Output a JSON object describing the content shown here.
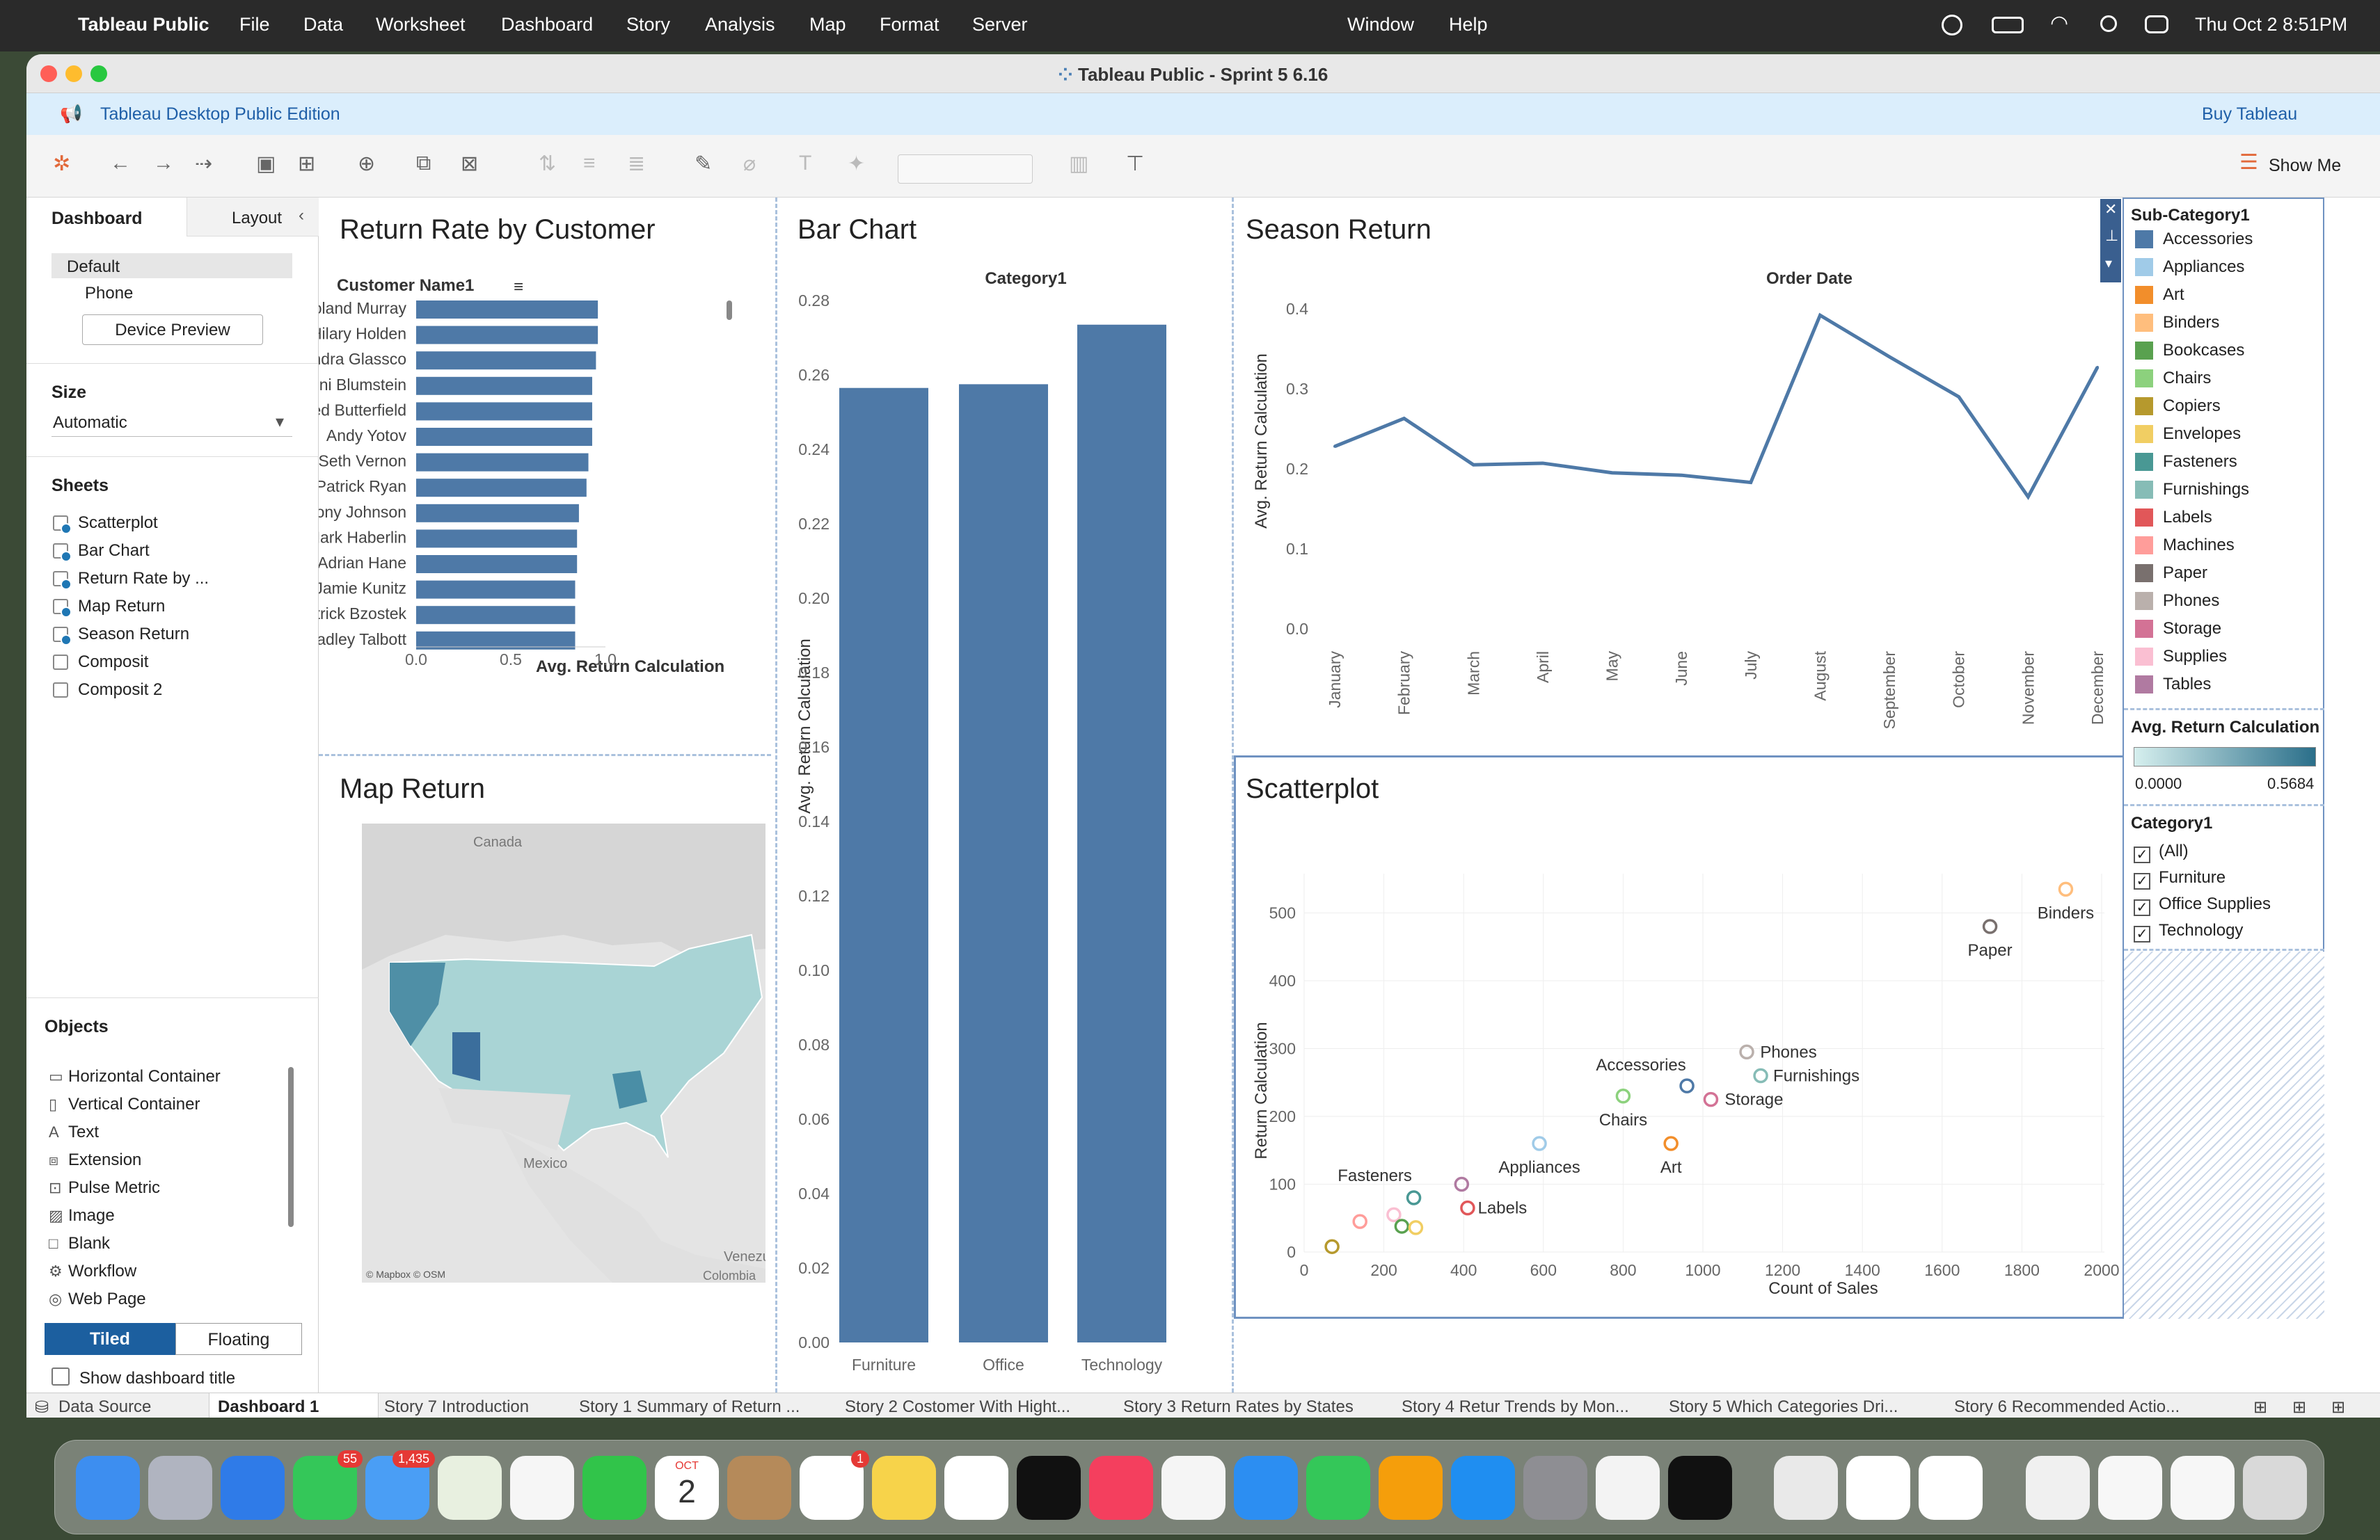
{
  "menubar": {
    "app": "Tableau Public",
    "items": [
      "File",
      "Data",
      "Worksheet",
      "Dashboard",
      "Story",
      "Analysis",
      "Map",
      "Format",
      "Server"
    ],
    "right_items": [
      "Window",
      "Help"
    ],
    "datetime": "Thu Oct 2  8:51PM"
  },
  "window": {
    "title": "Tableau Public - Sprint 5 6.16"
  },
  "banner": {
    "edition": "Tableau Desktop Public Edition",
    "buy": "Buy Tableau"
  },
  "toolbar": {
    "show_me": "Show Me"
  },
  "left": {
    "tab_dashboard": "Dashboard",
    "tab_layout": "Layout",
    "device_default": "Default",
    "device_phone": "Phone",
    "device_preview": "Device Preview",
    "size_header": "Size",
    "size_value": "Automatic",
    "sheets_header": "Sheets",
    "sheets": [
      "Scatterplot",
      "Bar Chart",
      "Return Rate by ...",
      "Map Return",
      "Season Return",
      "Composit",
      "Composit 2"
    ],
    "objects_header": "Objects",
    "objects": [
      "Horizontal Container",
      "Vertical Container",
      "Text",
      "Extension",
      "Pulse Metric",
      "Image",
      "Blank",
      "Workflow",
      "Web Page"
    ],
    "tiled": "Tiled",
    "floating": "Floating",
    "show_title": "Show dashboard title"
  },
  "panels": {
    "return_rate": "Return Rate by Customer",
    "bar_chart": "Bar Chart",
    "season": "Season Return",
    "map": "Map Return",
    "scatter": "Scatterplot"
  },
  "map": {
    "canada": "Canada",
    "mexico": "Mexico",
    "venezuela": "Venezu",
    "colombia": "Colombia",
    "credit": "© Mapbox © OSM"
  },
  "legend": {
    "subcat_title": "Sub-Category1",
    "subcats": [
      {
        "name": "Accessories",
        "color": "#4e79a7"
      },
      {
        "name": "Appliances",
        "color": "#a0cbe8"
      },
      {
        "name": "Art",
        "color": "#f28e2b"
      },
      {
        "name": "Binders",
        "color": "#ffbe7d"
      },
      {
        "name": "Bookcases",
        "color": "#59a14f"
      },
      {
        "name": "Chairs",
        "color": "#8cd17d"
      },
      {
        "name": "Copiers",
        "color": "#b6992d"
      },
      {
        "name": "Envelopes",
        "color": "#f1ce63"
      },
      {
        "name": "Fasteners",
        "color": "#499894"
      },
      {
        "name": "Furnishings",
        "color": "#86bcb6"
      },
      {
        "name": "Labels",
        "color": "#e15759"
      },
      {
        "name": "Machines",
        "color": "#ff9d9a"
      },
      {
        "name": "Paper",
        "color": "#79706e"
      },
      {
        "name": "Phones",
        "color": "#bab0ac"
      },
      {
        "name": "Storage",
        "color": "#d37295"
      },
      {
        "name": "Supplies",
        "color": "#fabfd2"
      },
      {
        "name": "Tables",
        "color": "#b07aa1"
      }
    ],
    "grad_title": "Avg. Return Calculation",
    "grad_min": "0.0000",
    "grad_max": "0.5684",
    "cat_title": "Category1",
    "cats": [
      "(All)",
      "Furniture",
      "Office Supplies",
      "Technology"
    ]
  },
  "tabs": [
    "Data Source",
    "Dashboard 1",
    "Story 7 Introduction",
    "Story 1 Summary of Return ...",
    "Story 2 Costomer With Hight...",
    "Story 3 Return Rates by States",
    "Story 4 Retur Trends by Mon...",
    "Story 5 Which Categories Dri...",
    "Story 6 Recommended Actio..."
  ],
  "dock": {
    "messages_badge": "55",
    "mail_badge": "1,435",
    "cal_month": "OCT",
    "cal_day": "2",
    "reminders_badge": "1"
  },
  "chart_data": [
    {
      "type": "bar",
      "orientation": "horizontal",
      "title": "Return Rate by Customer",
      "ylabel": "Customer Name1",
      "xlabel": "Avg. Return Calculation",
      "xlim": [
        0,
        1.0
      ],
      "xticks": [
        "0.0",
        "0.5",
        "1.0"
      ],
      "categories": [
        "Roland Murray",
        "Hilary Holden",
        "Sandra Glassco",
        "Joni Blumstein",
        "Ted Butterfield",
        "Andy Yotov",
        "Seth Vernon",
        "Patrick Ryan",
        "Anthony Johnson",
        "Mark Haberlin",
        "Adrian Hane",
        "Jamie Kunitz",
        "Patrick Bzostek",
        "Bradley Talbott"
      ],
      "values": [
        0.96,
        0.96,
        0.95,
        0.93,
        0.93,
        0.93,
        0.91,
        0.9,
        0.86,
        0.85,
        0.85,
        0.84,
        0.84,
        0.84
      ]
    },
    {
      "type": "bar",
      "title": "Bar Chart",
      "header": "Category1",
      "ylabel": "Avg. Return Calculation",
      "ylim": [
        0,
        0.28
      ],
      "yticks": [
        "0.00",
        "0.02",
        "0.04",
        "0.06",
        "0.08",
        "0.10",
        "0.12",
        "0.14",
        "0.16",
        "0.18",
        "0.20",
        "0.22",
        "0.24",
        "0.26",
        "0.28"
      ],
      "categories": [
        "Furniture",
        "Office Supplies",
        "Technology"
      ],
      "values": [
        0.2565,
        0.2575,
        0.2735
      ]
    },
    {
      "type": "line",
      "title": "Season Return",
      "header": "Order Date",
      "ylabel": "Avg. Return Calculation",
      "ylim": [
        0,
        0.4
      ],
      "yticks": [
        "0.0",
        "0.1",
        "0.2",
        "0.3",
        "0.4"
      ],
      "categories": [
        "January",
        "February",
        "March",
        "April",
        "May",
        "June",
        "July",
        "August",
        "September",
        "October",
        "November",
        "December"
      ],
      "values": [
        0.228,
        0.263,
        0.205,
        0.207,
        0.195,
        0.192,
        0.183,
        0.392,
        0.34,
        0.29,
        0.165,
        0.327
      ]
    },
    {
      "type": "scatter",
      "title": "Scatterplot",
      "xlabel": "Count of Sales",
      "ylabel": "Return Calculation",
      "xlim": [
        0,
        2000
      ],
      "ylim": [
        0,
        560
      ],
      "xticks": [
        "0",
        "200",
        "400",
        "600",
        "800",
        "1000",
        "1200",
        "1400",
        "1600",
        "1800",
        "2000"
      ],
      "yticks": [
        "0",
        "100",
        "200",
        "300",
        "400",
        "500"
      ],
      "points": [
        {
          "label": "Binders",
          "x": 1910,
          "y": 535,
          "color": "#ffbe7d"
        },
        {
          "label": "Paper",
          "x": 1720,
          "y": 480,
          "color": "#79706e"
        },
        {
          "label": "Phones",
          "x": 1110,
          "y": 295,
          "color": "#bab0ac"
        },
        {
          "label": "Furnishings",
          "x": 1145,
          "y": 260,
          "color": "#86bcb6"
        },
        {
          "label": "Accessories",
          "x": 960,
          "y": 245,
          "color": "#4e79a7"
        },
        {
          "label": "Storage",
          "x": 1020,
          "y": 225,
          "color": "#d37295"
        },
        {
          "label": "Chairs",
          "x": 800,
          "y": 230,
          "color": "#8cd17d"
        },
        {
          "label": "Art",
          "x": 920,
          "y": 160,
          "color": "#f28e2b"
        },
        {
          "label": "Appliances",
          "x": 590,
          "y": 160,
          "color": "#a0cbe8"
        },
        {
          "label": "Labels",
          "x": 410,
          "y": 65,
          "color": "#e15759"
        },
        {
          "label": "Fasteners",
          "x": 275,
          "y": 80,
          "color": "#499894"
        },
        {
          "label": "",
          "x": 395,
          "y": 100,
          "color": "#b07aa1"
        },
        {
          "label": "",
          "x": 140,
          "y": 45,
          "color": "#ff9d9a"
        },
        {
          "label": "",
          "x": 225,
          "y": 55,
          "color": "#fabfd2"
        },
        {
          "label": "",
          "x": 245,
          "y": 38,
          "color": "#59a14f"
        },
        {
          "label": "",
          "x": 280,
          "y": 36,
          "color": "#f1ce63"
        },
        {
          "label": "",
          "x": 70,
          "y": 8,
          "color": "#b6992d"
        }
      ]
    }
  ]
}
